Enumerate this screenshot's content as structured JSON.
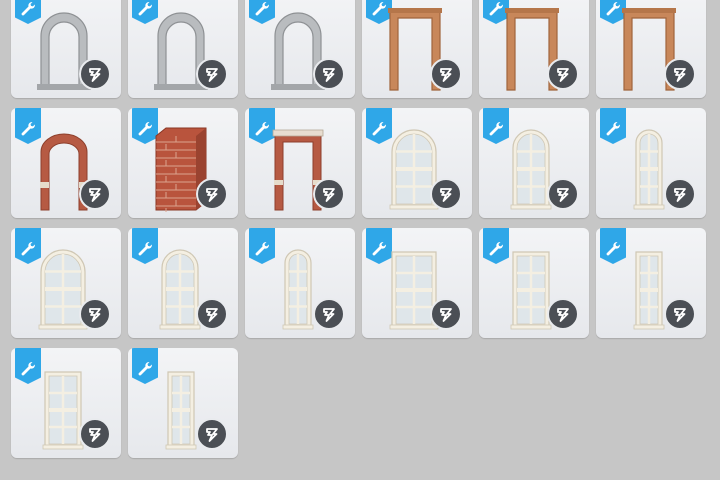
{
  "catalog": {
    "items": [
      {
        "kind": "arch-stone"
      },
      {
        "kind": "arch-stone"
      },
      {
        "kind": "arch-stone"
      },
      {
        "kind": "frame-wood"
      },
      {
        "kind": "frame-wood"
      },
      {
        "kind": "frame-wood"
      },
      {
        "kind": "arch-brick"
      },
      {
        "kind": "brick-column"
      },
      {
        "kind": "frame-brick"
      },
      {
        "kind": "window-arched-wide"
      },
      {
        "kind": "window-arched"
      },
      {
        "kind": "window-arched-narrow"
      },
      {
        "kind": "window-arched-wide"
      },
      {
        "kind": "window-arched"
      },
      {
        "kind": "window-arched-narrow"
      },
      {
        "kind": "window-sash-wide"
      },
      {
        "kind": "window-sash"
      },
      {
        "kind": "window-sash-narrow"
      },
      {
        "kind": "window-sash"
      },
      {
        "kind": "window-sash-narrow"
      }
    ]
  },
  "icons": {
    "ribbon": "wrench-icon",
    "badge": "pack-icon"
  },
  "colors": {
    "ribbon": "#2fa7e8",
    "badge": "#4b4f55",
    "tile": "#eceef1",
    "background": "#c6c6c6"
  }
}
